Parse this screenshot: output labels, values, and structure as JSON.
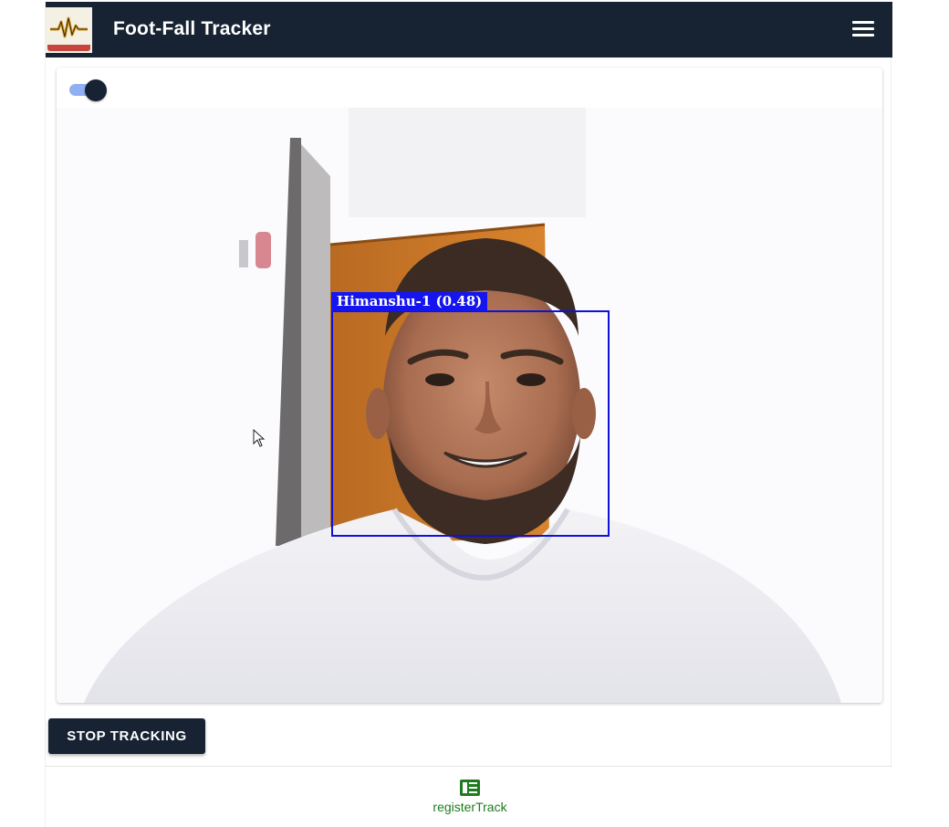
{
  "header": {
    "title": "Foot-Fall Tracker",
    "logo_icon": "heartbeat-logo",
    "menu_icon": "hamburger-menu-icon",
    "background_color": "#172333"
  },
  "camera": {
    "toggle_state": "on",
    "toggle_accent": "#8fb0f2",
    "detection": {
      "label": "Himanshu-1 (0.48)",
      "box_color": "#0f10d9"
    }
  },
  "actions": {
    "stop_label": "STOP TRACKING"
  },
  "bottom_nav": {
    "items": [
      {
        "label": "registerTrack",
        "icon": "register-list-icon",
        "color": "#1e7b1e"
      }
    ]
  }
}
